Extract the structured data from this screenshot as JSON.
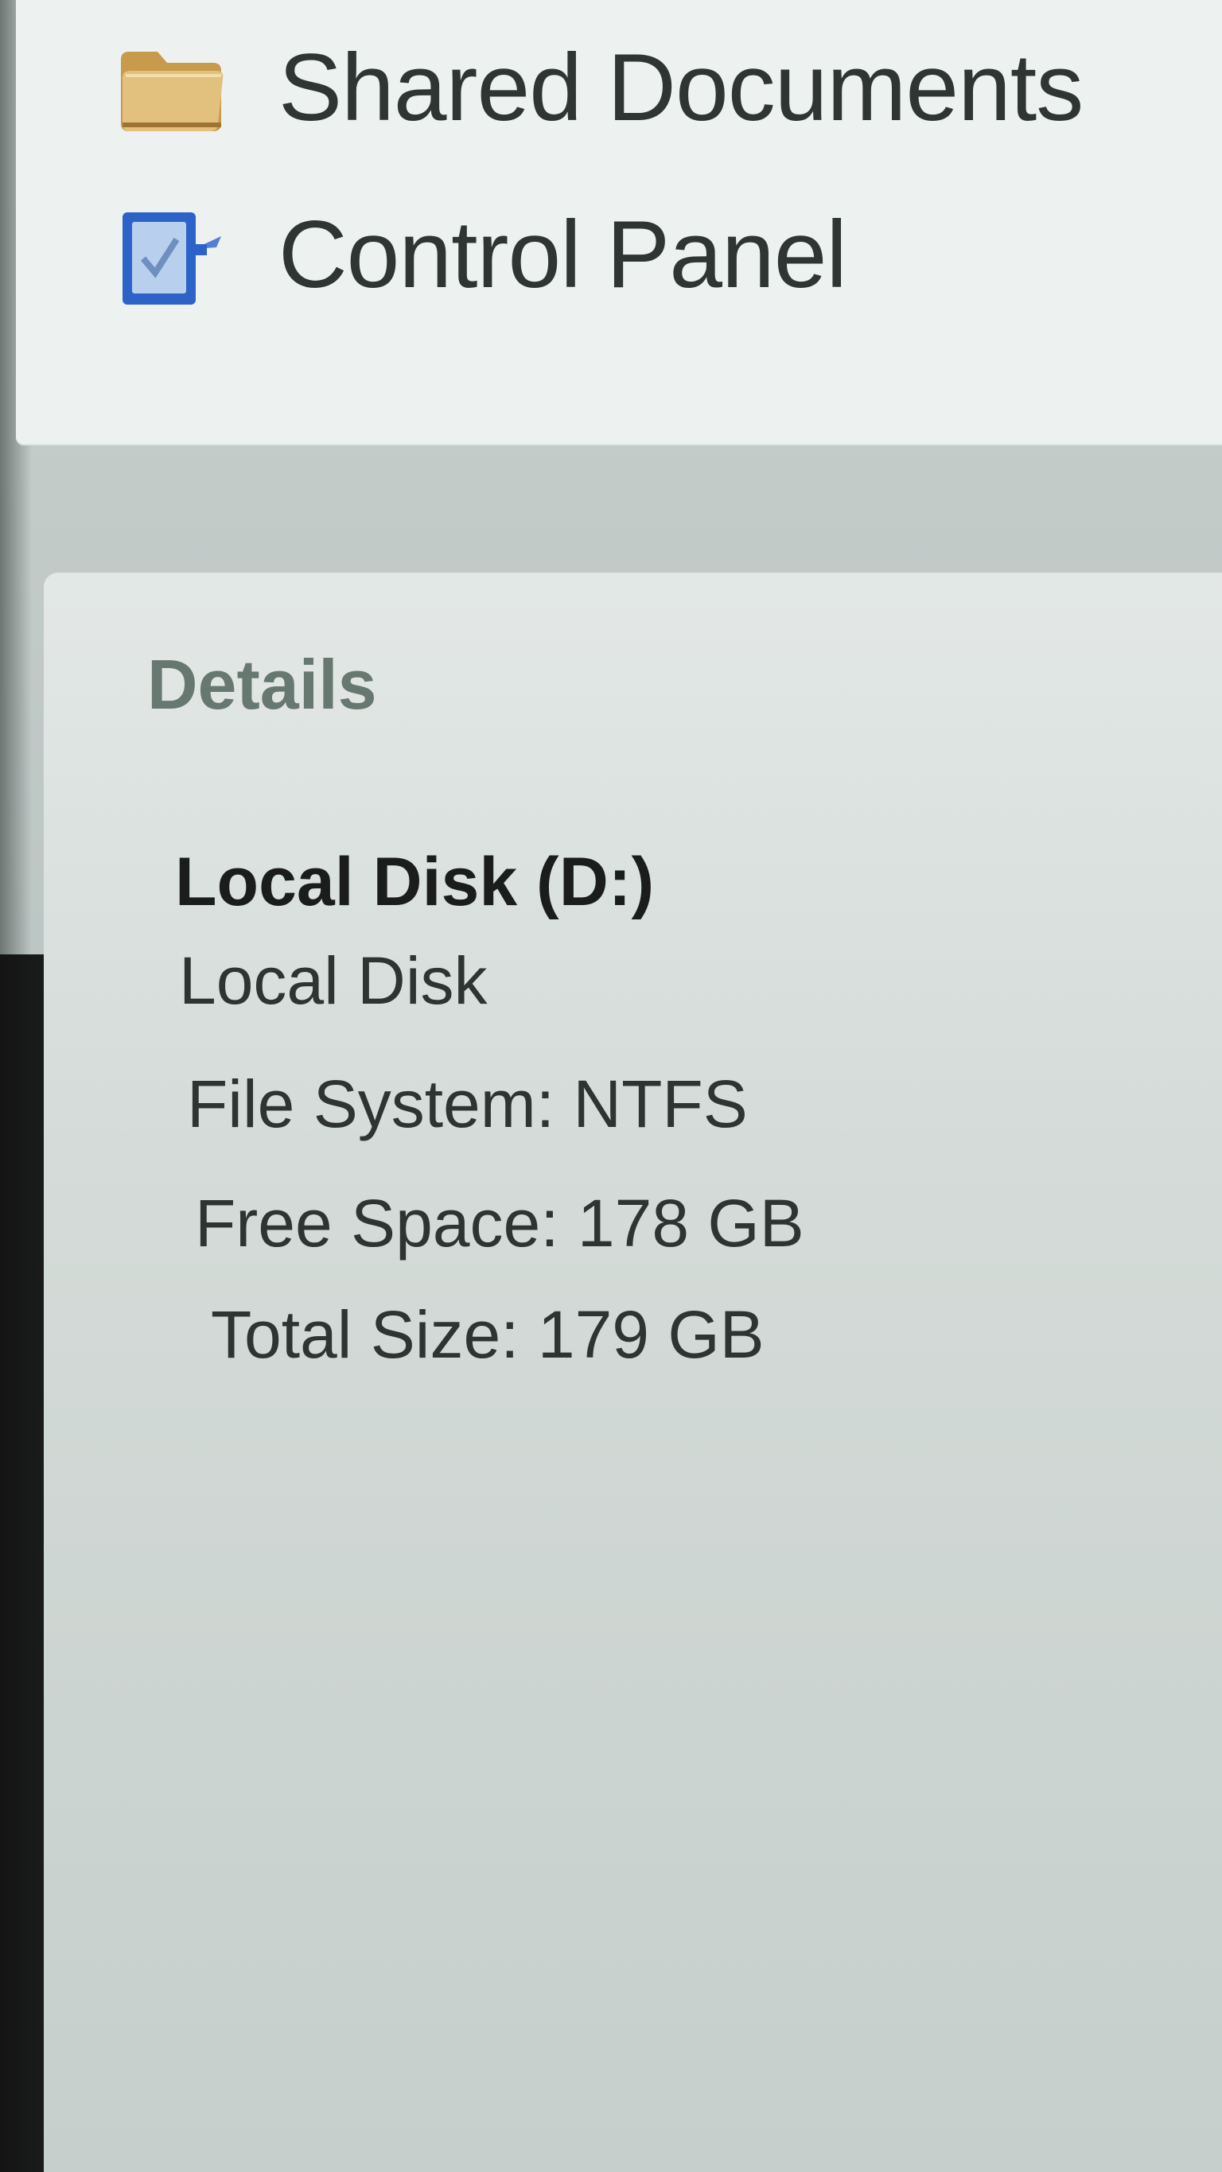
{
  "other_places": {
    "items": [
      {
        "label": "Shared Documents",
        "icon": "folder-icon"
      },
      {
        "label": "Control Panel",
        "icon": "control-panel-icon"
      }
    ]
  },
  "details": {
    "title": "Details",
    "name": "Local Disk (D:)",
    "type": "Local Disk",
    "file_system": "File System: NTFS",
    "free_space": "Free Space: 178 GB",
    "total_size": "Total Size: 179 GB"
  },
  "colors": {
    "pane_background": "#edf1ef",
    "details_title": "#66786f",
    "folder": "#d9b36a",
    "control_panel_blue": "#2d63c8"
  }
}
